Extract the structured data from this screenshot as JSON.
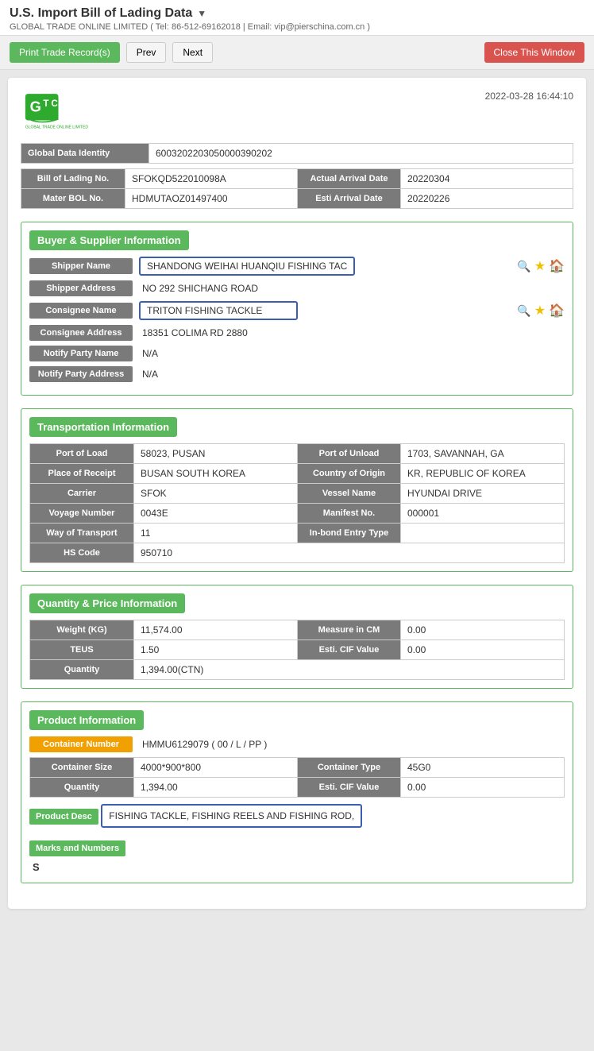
{
  "page": {
    "title": "U.S. Import Bill of Lading Data",
    "subtitle": "GLOBAL TRADE ONLINE LIMITED ( Tel: 86-512-69162018 | Email: vip@pierschina.com.cn )",
    "datetime": "2022-03-28 16:44:10"
  },
  "toolbar": {
    "print_label": "Print Trade Record(s)",
    "prev_label": "Prev",
    "next_label": "Next",
    "close_label": "Close This Window"
  },
  "global_data": {
    "global_identity_label": "Global Data Identity",
    "global_identity_value": "6003202203050000390202",
    "bill_of_lading_label": "Bill of Lading No.",
    "bill_of_lading_value": "SFOKQD522010098A",
    "actual_arrival_label": "Actual Arrival Date",
    "actual_arrival_value": "20220304",
    "mater_bol_label": "Mater BOL No.",
    "mater_bol_value": "HDMUTAOZ01497400",
    "esti_arrival_label": "Esti Arrival Date",
    "esti_arrival_value": "20220226"
  },
  "buyer_supplier": {
    "section_title": "Buyer & Supplier Information",
    "shipper_name_label": "Shipper Name",
    "shipper_name_value": "SHANDONG WEIHAI HUANQIU FISHING TAC",
    "shipper_address_label": "Shipper Address",
    "shipper_address_value": "NO 292 SHICHANG ROAD",
    "consignee_name_label": "Consignee Name",
    "consignee_name_value": "TRITON FISHING TACKLE",
    "consignee_address_label": "Consignee Address",
    "consignee_address_value": "18351 COLIMA RD 2880",
    "notify_party_name_label": "Notify Party Name",
    "notify_party_name_value": "N/A",
    "notify_party_address_label": "Notify Party Address",
    "notify_party_address_value": "N/A"
  },
  "transportation": {
    "section_title": "Transportation Information",
    "port_of_load_label": "Port of Load",
    "port_of_load_value": "58023, PUSAN",
    "port_of_unload_label": "Port of Unload",
    "port_of_unload_value": "1703, SAVANNAH, GA",
    "place_of_receipt_label": "Place of Receipt",
    "place_of_receipt_value": "BUSAN SOUTH KOREA",
    "country_label": "Country of Origin",
    "country_value": "KR, REPUBLIC OF KOREA",
    "carrier_label": "Carrier",
    "carrier_value": "SFOK",
    "vessel_name_label": "Vessel Name",
    "vessel_name_value": "HYUNDAI DRIVE",
    "voyage_number_label": "Voyage Number",
    "voyage_number_value": "0043E",
    "manifest_no_label": "Manifest No.",
    "manifest_no_value": "000001",
    "way_of_transport_label": "Way of Transport",
    "way_of_transport_value": "11",
    "inbond_entry_label": "In-bond Entry Type",
    "inbond_entry_value": "",
    "hs_code_label": "HS Code",
    "hs_code_value": "950710"
  },
  "quantity_price": {
    "section_title": "Quantity & Price Information",
    "weight_label": "Weight (KG)",
    "weight_value": "11,574.00",
    "measure_label": "Measure in CM",
    "measure_value": "0.00",
    "teus_label": "TEUS",
    "teus_value": "1.50",
    "esti_cif_label": "Esti. CIF Value",
    "esti_cif_value": "0.00",
    "quantity_label": "Quantity",
    "quantity_value": "1,394.00(CTN)"
  },
  "product": {
    "section_title": "Product Information",
    "container_number_label": "Container Number",
    "container_number_value": "HMMU6129079 ( 00 / L / PP )",
    "container_size_label": "Container Size",
    "container_size_value": "4000*900*800",
    "container_type_label": "Container Type",
    "container_type_value": "45G0",
    "quantity_label": "Quantity",
    "quantity_value": "1,394.00",
    "esti_cif_label": "Esti. CIF Value",
    "esti_cif_value": "0.00",
    "product_desc_label": "Product Desc",
    "product_desc_value": "FISHING TACKLE, FISHING REELS AND FISHING ROD,",
    "marks_label": "Marks and Numbers",
    "marks_value": "S"
  }
}
